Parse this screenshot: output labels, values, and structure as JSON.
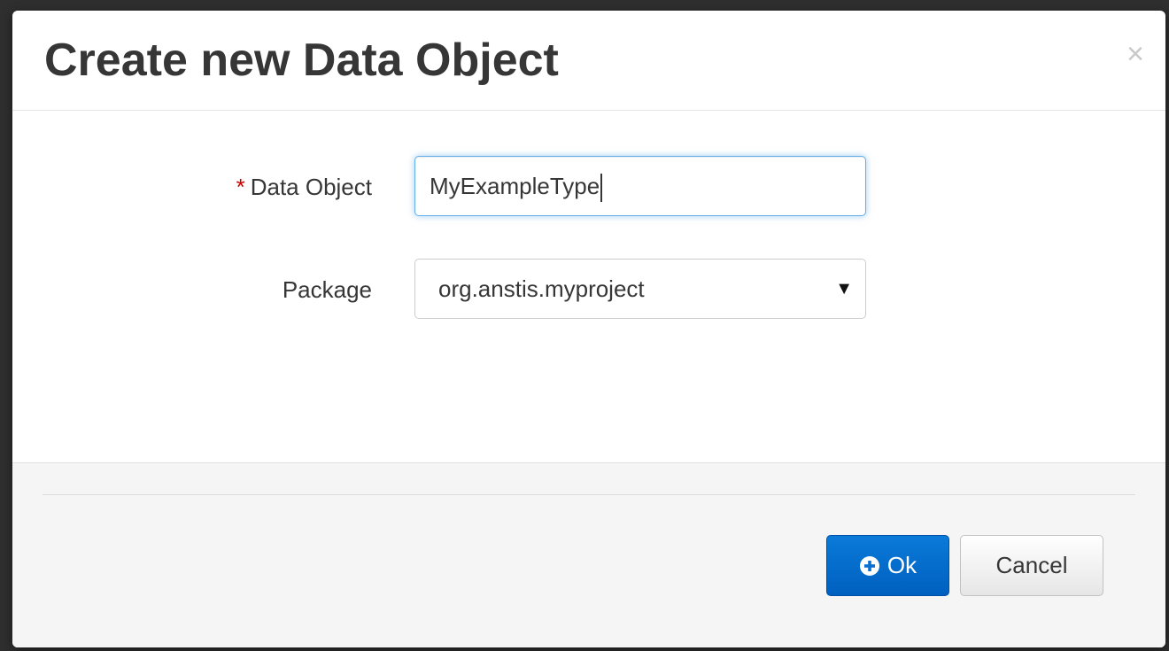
{
  "dialog": {
    "title": "Create new Data Object",
    "close_symbol": "×"
  },
  "form": {
    "data_object": {
      "required_marker": "*",
      "label": "Data Object",
      "value": "MyExampleType"
    },
    "package": {
      "label": "Package",
      "selected": "org.anstis.myproject",
      "arrow": "▼"
    }
  },
  "footer": {
    "ok_label": "Ok",
    "ok_icon": "plus-circle-icon",
    "cancel_label": "Cancel"
  },
  "colors": {
    "primary": "#0a6fd0",
    "required": "#cc0000",
    "focus_border": "#66afe9"
  }
}
